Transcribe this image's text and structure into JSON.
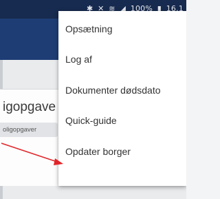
{
  "status_bar": {
    "battery_percent": "100%",
    "time": "16.1",
    "icons": [
      "bluetooth-icon",
      "mute-icon",
      "wifi-icon",
      "signal-icon",
      "battery-icon"
    ]
  },
  "card": {
    "title": "igopgave",
    "tag": "oligopgaver"
  },
  "menu": {
    "items": [
      {
        "label": "Opsætning"
      },
      {
        "label": "Log af"
      },
      {
        "label": "Dokumenter dødsdato"
      },
      {
        "label": "Quick-guide"
      },
      {
        "label": "Opdater borger"
      }
    ]
  },
  "annotation": {
    "arrow_color": "#e0262b",
    "target": "Opdater borger"
  },
  "colors": {
    "status_bar": "#172a4f",
    "app_bar": "#1e3d75",
    "menu_background": "#ffffff"
  }
}
